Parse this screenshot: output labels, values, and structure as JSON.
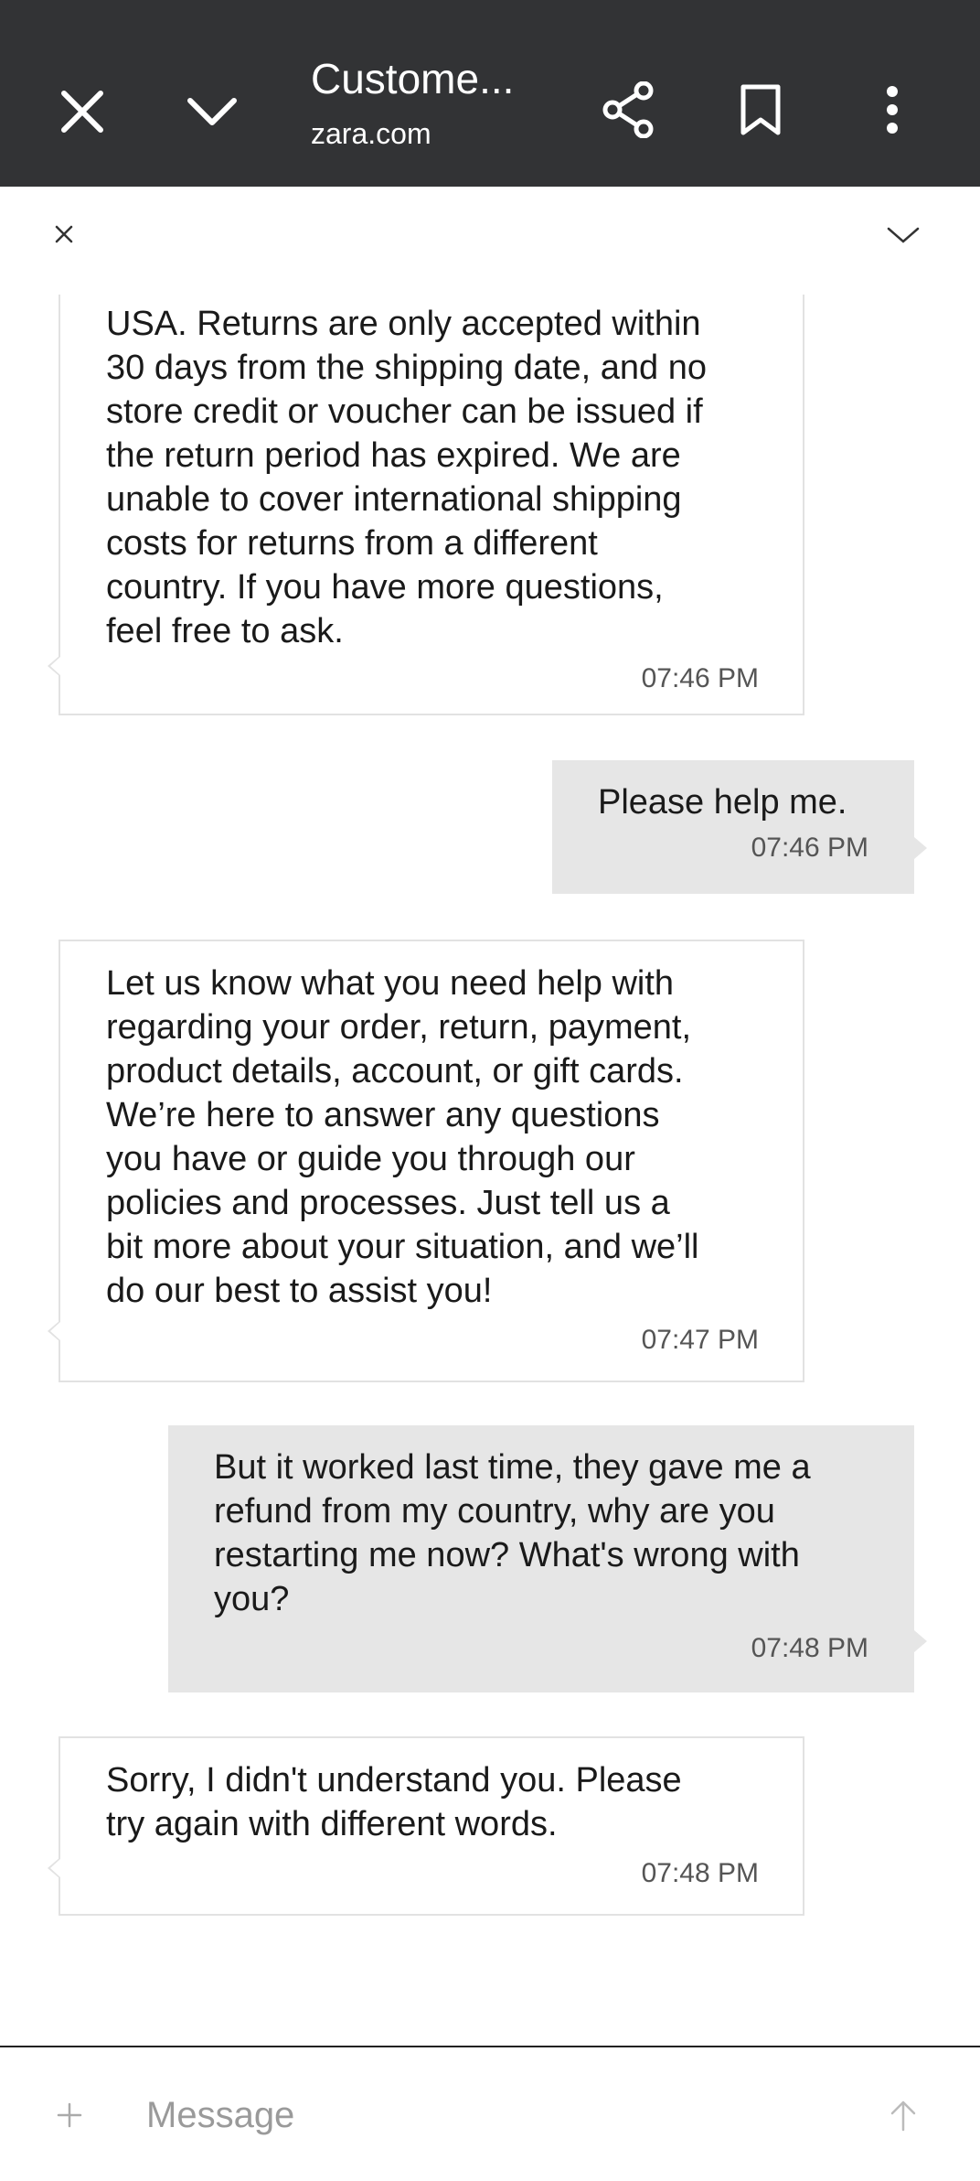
{
  "browser": {
    "title": "Custome...",
    "url": "zara.com",
    "icons": {
      "close": "close-icon",
      "minimize": "chevron-down-icon",
      "share": "share-icon",
      "bookmark": "bookmark-icon",
      "more": "more-vert-icon"
    }
  },
  "chat_header": {
    "icons": {
      "close": "close-icon",
      "collapse": "chevron-down-icon"
    }
  },
  "messages": [
    {
      "sender": "bot",
      "text": "USA. Returns are only accepted within\n30 days from the shipping date, and no\nstore credit or voucher can be issued if\nthe return period has expired. We are\nunable to cover international shipping\ncosts for returns from a different\ncountry. If you have more questions,\nfeel free to ask.",
      "time": "07:46 PM"
    },
    {
      "sender": "user",
      "text": "Please help me.",
      "time": "07:46 PM"
    },
    {
      "sender": "bot",
      "text": "Let us know what you need help with\nregarding your order, return, payment,\nproduct details, account, or gift cards.\nWe’re here to answer any questions\nyou have or guide you through our\npolicies and processes. Just tell us a\nbit more about your situation, and we’ll\ndo our best to assist you!",
      "time": "07:47 PM"
    },
    {
      "sender": "user",
      "text": "But it worked last time, they gave me a\nrefund from my country, why are you\nrestarting me now? What's wrong with\nyou?",
      "time": "07:48 PM"
    },
    {
      "sender": "bot",
      "text": "Sorry, I didn't understand you. Please\ntry again with different words.",
      "time": "07:48 PM"
    }
  ],
  "composer": {
    "placeholder": "Message",
    "icons": {
      "attach": "plus-icon",
      "send": "arrow-up-icon"
    }
  },
  "colors": {
    "toolbar_bg": "#323335",
    "user_bubble": "#e6e6e6",
    "bot_bubble_border": "#e2e2e2"
  }
}
